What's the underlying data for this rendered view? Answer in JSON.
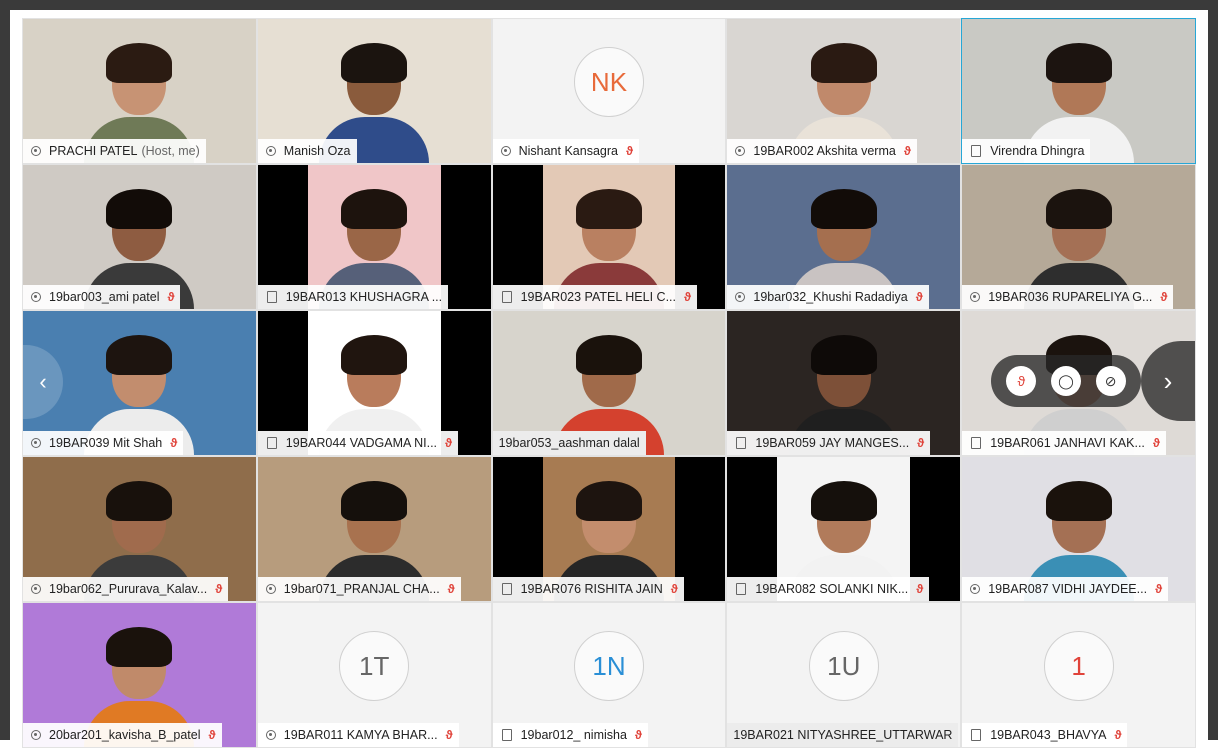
{
  "colors": {
    "accent": "#27a7d6",
    "mute": "#e0433a",
    "tile_bg": "#f3f3f3"
  },
  "icons": {
    "mic": "microphone-icon",
    "mute": "mic-muted-icon",
    "device": "phone-icon",
    "audio": "headset-icon",
    "chat": "chat-icon",
    "stop": "stop-video-icon",
    "next": "chevron-right-icon",
    "prev": "chevron-left-icon"
  },
  "participants": [
    {
      "name": "PRACHI PATEL",
      "role": "(Host, me)",
      "muted": false,
      "icon": "audio",
      "bg": "#d8d2c6",
      "skin": "#c79374",
      "hair": "#2b1b12",
      "shirt": "#6f7a57"
    },
    {
      "name": "Manish Oza",
      "role": "",
      "muted": false,
      "icon": "audio",
      "bg": "#e6dfd3",
      "skin": "#8a5b3c",
      "hair": "#1b140f",
      "shirt": "#2f4c8a"
    },
    {
      "name": "Nishant Kansagra",
      "role": "",
      "muted": true,
      "icon": "audio",
      "avatar": "NK",
      "avatar_color": "#e86a3a"
    },
    {
      "name": "19BAR002 Akshita verma",
      "role": "",
      "muted": true,
      "icon": "audio",
      "bg": "#d9d6d2",
      "skin": "#c0896b",
      "hair": "#2a1a12",
      "shirt": "#e9e2d8"
    },
    {
      "name": "Virendra Dhingra",
      "role": "",
      "muted": false,
      "icon": "device",
      "bg": "#c9c9c4",
      "skin": "#b07857",
      "hair": "#1c1410",
      "shirt": "#f2f2f2",
      "active": true
    },
    {
      "name": "19bar003_ami patel",
      "role": "",
      "muted": true,
      "icon": "audio",
      "bg": "#cfcac4",
      "skin": "#8e5c41",
      "hair": "#120c08",
      "shirt": "#3a3a3a"
    },
    {
      "name": "19BAR013 KHUSHAGRA ...",
      "role": "",
      "muted": false,
      "icon": "device",
      "bg": "#f0c6c8",
      "skin": "#9a6647",
      "hair": "#1d130d",
      "shirt": "#566079",
      "bars": true
    },
    {
      "name": "19BAR023 PATEL HELI C...",
      "role": "",
      "muted": true,
      "icon": "device",
      "bg": "#e3c9b6",
      "skin": "#b98061",
      "hair": "#2a1a12",
      "shirt": "#8a3a3a",
      "bars": true
    },
    {
      "name": "19bar032_Khushi Radadiya",
      "role": "",
      "muted": true,
      "icon": "audio",
      "bg": "#5b6e8f",
      "skin": "#a56f4f",
      "hair": "#120c08",
      "shirt": "#c9c3c2"
    },
    {
      "name": "19BAR036 RUPARELIYA G...",
      "role": "",
      "muted": true,
      "icon": "audio",
      "bg": "#b5a998",
      "skin": "#a47055",
      "hair": "#1b130e",
      "shirt": "#2e2e2e"
    },
    {
      "name": "19BAR039 Mit Shah",
      "role": "",
      "muted": true,
      "icon": "audio",
      "bg": "#4a7fb0",
      "skin": "#c28d6e",
      "hair": "#1d140f",
      "shirt": "#ececec",
      "prev": true
    },
    {
      "name": "19BAR044 VADGAMA NI...",
      "role": "",
      "muted": true,
      "icon": "device",
      "bg": "#ffffff",
      "skin": "#b97c5c",
      "hair": "#20150f",
      "shirt": "#f0f0f0",
      "bars": true
    },
    {
      "name": "19bar053_aashman dalal",
      "role": "",
      "muted": false,
      "icon": "none",
      "bg": "#d7d4cc",
      "skin": "#a06a4a",
      "hair": "#1a120c",
      "shirt": "#d4412e",
      "plain": true
    },
    {
      "name": "19BAR059 JAY MANGES...",
      "role": "",
      "muted": true,
      "icon": "device",
      "bg": "#2b2522",
      "skin": "#7d5038",
      "hair": "#0e0a08",
      "shirt": "#1f1f1f"
    },
    {
      "name": "19BAR061 JANHAVI KAK...",
      "role": "",
      "muted": true,
      "icon": "device",
      "bg": "#dedad6",
      "skin": "#c08a6c",
      "hair": "#1b130e",
      "shirt": "#cfcfcf",
      "controls": true
    },
    {
      "name": "19bar062_Pururava_Kalav...",
      "role": "",
      "muted": true,
      "icon": "audio",
      "bg": "#8f6d4b",
      "skin": "#a06b4d",
      "hair": "#18110c",
      "shirt": "#3b3b3b"
    },
    {
      "name": "19bar071_PRANJAL CHA...",
      "role": "",
      "muted": true,
      "icon": "audio",
      "bg": "#b79c7d",
      "skin": "#a8724f",
      "hair": "#15100c",
      "shirt": "#2c2c2c"
    },
    {
      "name": "19BAR076 RISHITA JAIN",
      "role": "",
      "muted": true,
      "icon": "device",
      "bg": "#a77b52",
      "skin": "#c38d6d",
      "hair": "#1d140f",
      "shirt": "#262626",
      "bars": true
    },
    {
      "name": "19BAR082 SOLANKI NIK...",
      "role": "",
      "muted": true,
      "icon": "device",
      "bg": "#f4f4f4",
      "skin": "#b17b5b",
      "hair": "#15100c",
      "shirt": "#f2f2f2",
      "bars": true
    },
    {
      "name": "19BAR087 VIDHI JAYDEE...",
      "role": "",
      "muted": true,
      "icon": "audio",
      "bg": "#e0dfe4",
      "skin": "#a47054",
      "hair": "#1a120c",
      "shirt": "#3a8fb5"
    },
    {
      "name": "20bar201_kavisha_B_patel",
      "role": "",
      "muted": true,
      "icon": "audio",
      "bg": "#b07ad8",
      "skin": "#c08a6a",
      "hair": "#1a120c",
      "shirt": "#e07a24"
    },
    {
      "name": "19BAR011 KAMYA BHAR...",
      "role": "",
      "muted": true,
      "icon": "audio",
      "avatar": "1T",
      "avatar_color": "#666666"
    },
    {
      "name": "19bar012_ nimisha",
      "role": "",
      "muted": true,
      "icon": "device",
      "avatar": "1N",
      "avatar_color": "#2a8fd6"
    },
    {
      "name": "19BAR021 NITYASHREE_UTTARWAR",
      "role": "",
      "muted": false,
      "icon": "none",
      "avatar": "1U",
      "avatar_color": "#666666",
      "plain": true
    },
    {
      "name": "19BAR043_BHAVYA",
      "role": "",
      "muted": true,
      "icon": "device",
      "avatar": "1",
      "avatar_color": "#e0433a"
    }
  ],
  "controls": {
    "mute_glyph": "🎙",
    "chat_glyph": "◯",
    "stop_glyph": "⊘",
    "next_glyph": "›",
    "prev_glyph": "‹",
    "muted_glyph": "ϑ"
  }
}
